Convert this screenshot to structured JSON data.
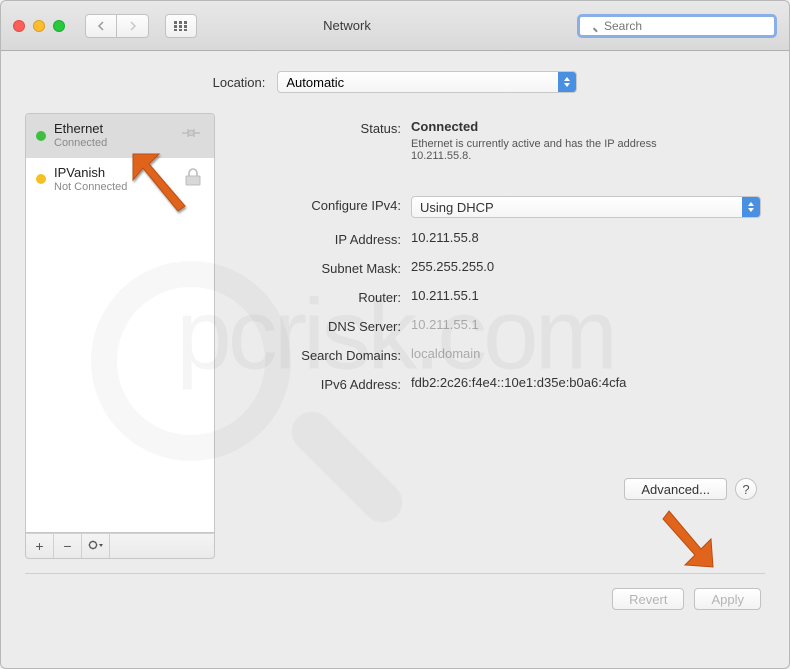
{
  "window": {
    "title": "Network"
  },
  "search": {
    "placeholder": "Search"
  },
  "location": {
    "label": "Location:",
    "value": "Automatic"
  },
  "sidebar": {
    "items": [
      {
        "name": "Ethernet",
        "status": "Connected",
        "dot": "green"
      },
      {
        "name": "IPVanish",
        "status": "Not Connected",
        "dot": "yellow"
      }
    ]
  },
  "details": {
    "status_label": "Status:",
    "status_value": "Connected",
    "status_desc": "Ethernet is currently active and has the IP address 10.211.55.8.",
    "configure_label": "Configure IPv4:",
    "configure_value": "Using DHCP",
    "ip_label": "IP Address:",
    "ip_value": "10.211.55.8",
    "subnet_label": "Subnet Mask:",
    "subnet_value": "255.255.255.0",
    "router_label": "Router:",
    "router_value": "10.211.55.1",
    "dns_label": "DNS Server:",
    "dns_value": "10.211.55.1",
    "searchdom_label": "Search Domains:",
    "searchdom_value": "localdomain",
    "ipv6_label": "IPv6 Address:",
    "ipv6_value": "fdb2:2c26:f4e4::10e1:d35e:b0a6:4cfa"
  },
  "buttons": {
    "advanced": "Advanced...",
    "help": "?",
    "revert": "Revert",
    "apply": "Apply",
    "add": "+",
    "remove": "−",
    "gear": "✻▾"
  },
  "watermark": "pcrisk.com"
}
